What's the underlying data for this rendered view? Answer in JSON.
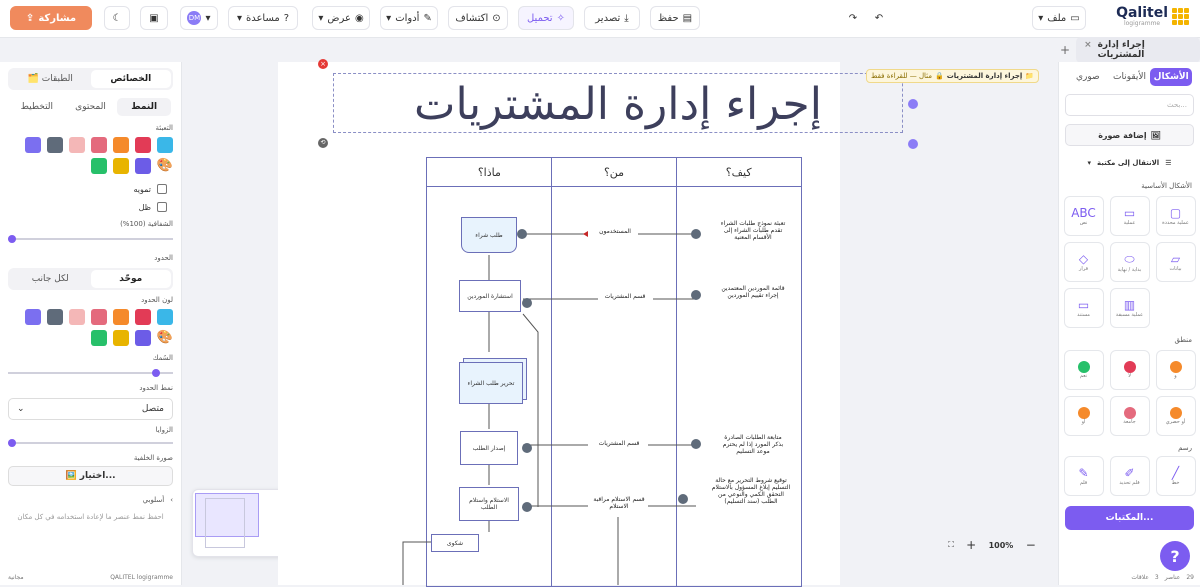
{
  "topbar": {
    "share": "مشاركة",
    "help": "مساعدة",
    "view": "عرض",
    "tools": "أدوات",
    "explore": "اكتشاف",
    "export": "تحميل",
    "publish": "تصدير",
    "save": "حفظ",
    "file": "ملف",
    "avatar": "DM"
  },
  "logo": {
    "name": "Qalitel",
    "sub": "logigramme"
  },
  "tab": {
    "title": "إجراء إدارة المشتريات",
    "badge": "إجراء إدارة المشتريات",
    "badge_note": "مثال — للقراءة فقط"
  },
  "left": {
    "tab_props": "الخصائص",
    "tab_layers": "الطبقات",
    "sub_style": "النمط",
    "sub_content": "المحتوى",
    "sub_layout": "التخطيط",
    "fill_label": "التعبئة",
    "blur_label": "تمويه",
    "shadow_label": "ظل",
    "opacity_label": "الشفافية (100%)",
    "border_label": "الحدود",
    "uniform": "موحّد",
    "per_side": "لكل جانب",
    "border_color_label": "لون الحدود",
    "thickness_label": "السُمك",
    "border_style_label": "نمط الحدود",
    "border_style_value": "متصل",
    "corners_label": "الزوايا",
    "cover_label": "صورة الخلفية",
    "cover_btn": "🖼️ اختيار...",
    "templates_label": "أسلوبي",
    "templates_hint": "احفظ نمط عنصر ما لإعادة استخدامه في كل مكان",
    "footer_left": "QALITEL logigramme",
    "footer_mid": "مجانية",
    "fill_colors": [
      "#7b6ff0",
      "#5f6b7a",
      "#f4b7b7",
      "#e46a7d",
      "#f58a2b",
      "#e23b56",
      "#3ab7e8",
      "#27c06a",
      "#e8b400",
      "#6c5ce7"
    ]
  },
  "right": {
    "tab_shapes": "الأشكال",
    "tab_icons": "الأيقونات",
    "tab_images": "صوري",
    "search_ph": "بحث...",
    "add_image": "إضافة صورة",
    "goto_lib": "الانتقال إلى مكتبة",
    "sec_basic": "الأشكال الأساسية",
    "sec_logic": "منطق",
    "sec_draw": "رسم",
    "lib_btn": "المكتبات...",
    "footer_a": "29",
    "footer_b": "عناصر",
    "footer_c": "3",
    "footer_d": "علاقات",
    "basic_shapes": [
      "نص",
      "عملية",
      "عملية محددة",
      "قرار",
      "بداية / نهاية",
      "بيانات",
      "مستند",
      "عملية مسبقة"
    ],
    "logic_shapes": [
      "نعم",
      "لا",
      "و",
      "أو",
      "جامعة",
      "أو حصري"
    ],
    "draw_shapes": [
      "قلم",
      "قلم تحديد",
      "خط"
    ]
  },
  "diagram": {
    "title": "إجراء إدارة المشتريات",
    "col1": "ماذا؟",
    "col2": "من؟",
    "col3": "كيف؟",
    "steps": [
      "طلب شراء",
      "استشارة الموردين",
      "تحرير طلب الشراء",
      "إصدار الطلب",
      "الاستلام واستلام الطلب",
      "شكوى"
    ],
    "who": [
      "المستخدمون",
      "قسم المشتريات",
      "قسم المشتريات",
      "قسم الاستلام مراقبة الاستلام"
    ],
    "how": [
      "تعبئة نموذج طلبات الشراء تقدم طلبات الشراء إلى الأقسام المعنية",
      "قائمة الموردين المعتمدين إجراء تقييم الموردين",
      "متابعة الطلبات الصادرة بذكر المورد إذا لم يحترم موعد التسليم",
      "توقيع شروط التحرير مع حالة التسليم إبلاغ المسؤول بالاستلام التحقق الكمي والنوعي من الطلب (سند التسليم)"
    ]
  },
  "zoom": {
    "value": "100%"
  }
}
